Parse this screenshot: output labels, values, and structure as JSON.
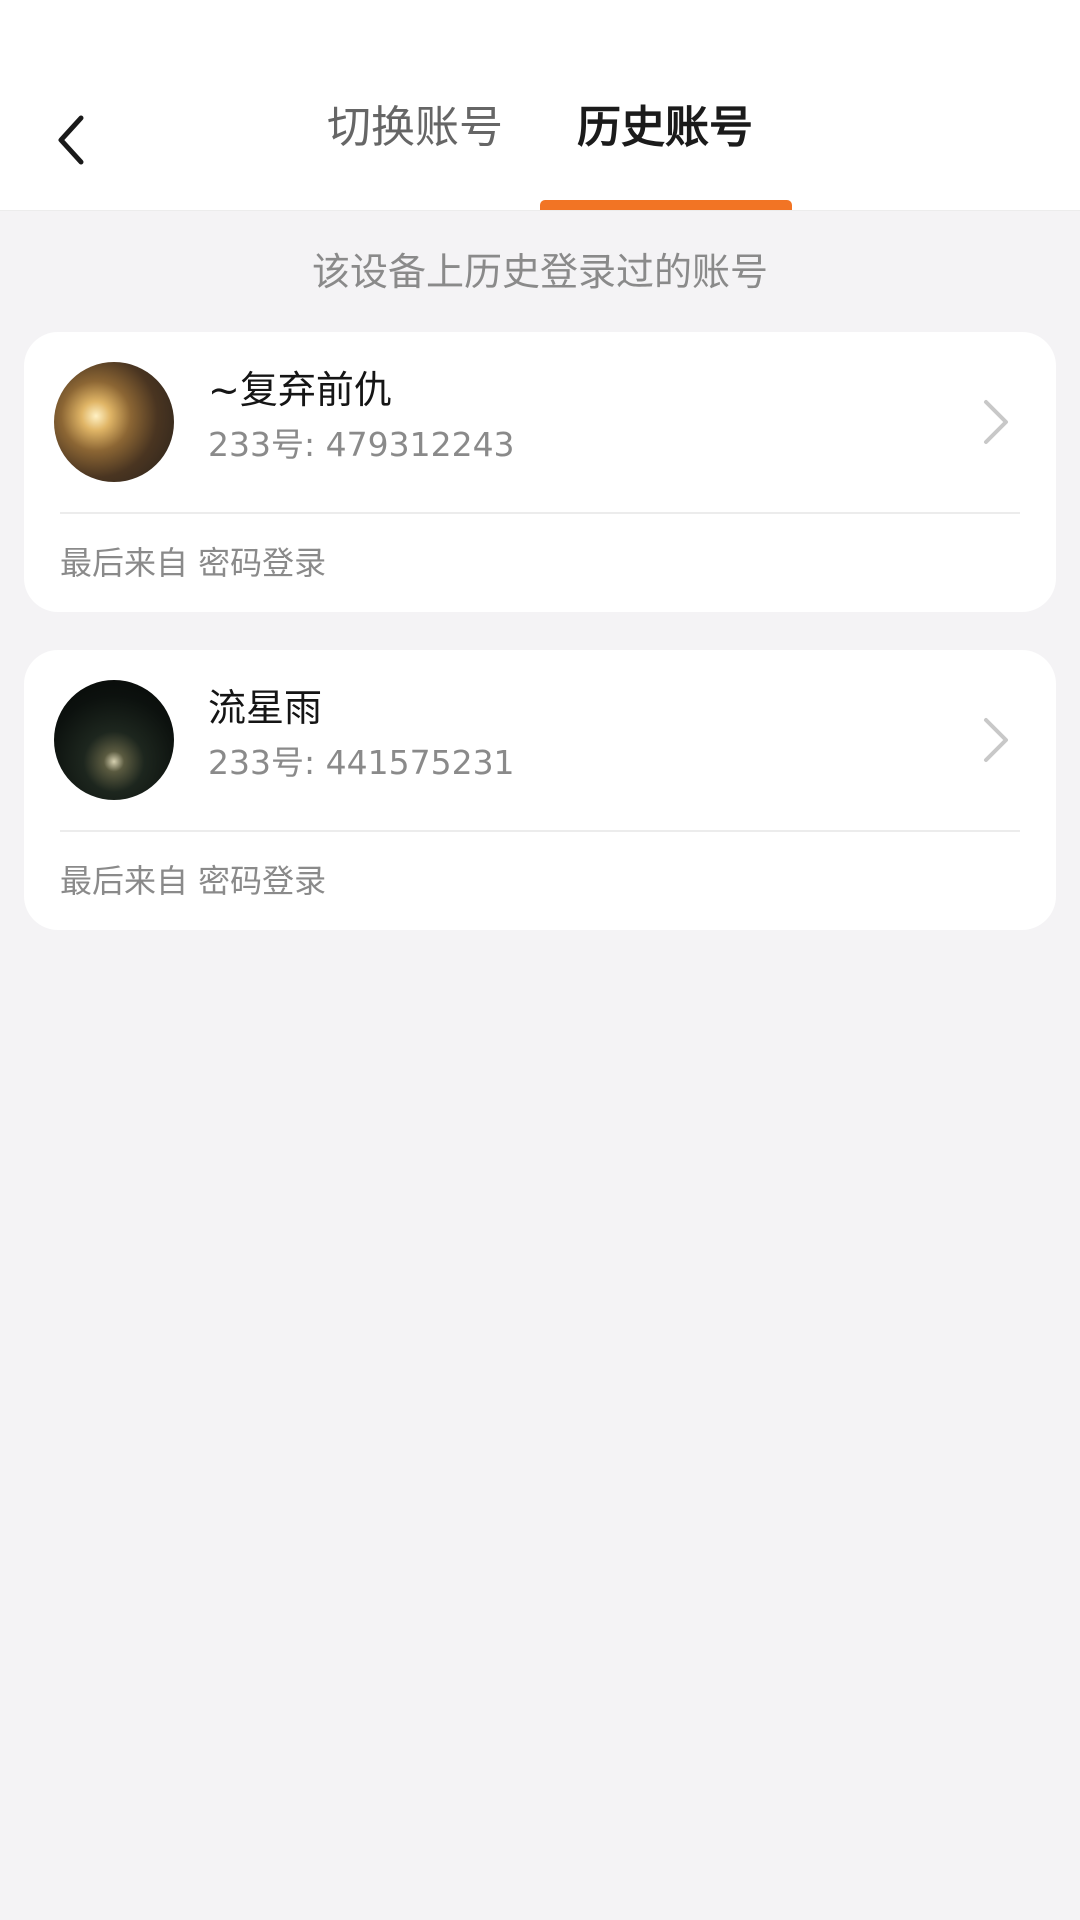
{
  "header": {
    "tabs": [
      {
        "label": "切换账号",
        "active": false
      },
      {
        "label": "历史账号",
        "active": true
      }
    ]
  },
  "subtitle": "该设备上历史登录过的账号",
  "accounts": [
    {
      "name": "~复弃前仇",
      "id_text": "233号: 479312243",
      "login_source": "最后来自 密码登录"
    },
    {
      "name": "流星雨",
      "id_text": "233号: 441575231",
      "login_source": "最后来自 密码登录"
    }
  ],
  "colors": {
    "accent": "#f27424",
    "background": "#f4f3f5",
    "card": "#ffffff",
    "primary_text": "#151515",
    "secondary_text": "#8a8a8a"
  }
}
